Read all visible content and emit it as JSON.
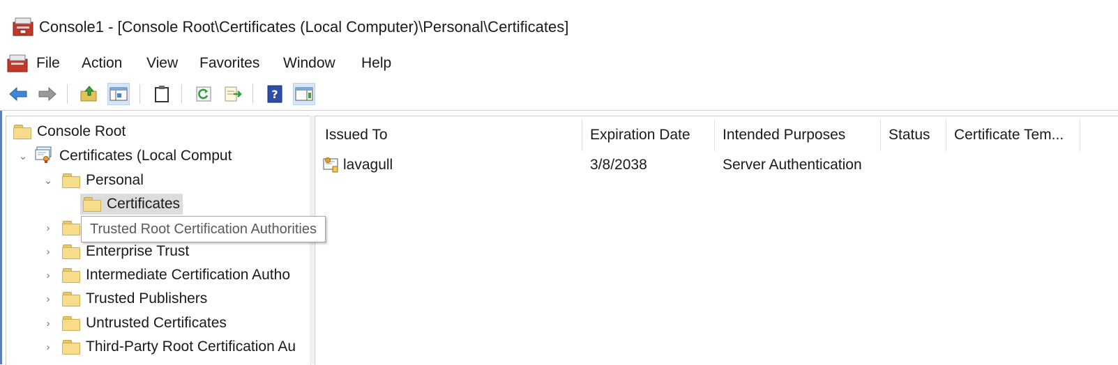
{
  "window": {
    "title": "Console1 - [Console Root\\Certificates (Local Computer)\\Personal\\Certificates]"
  },
  "menu": {
    "items": [
      "File",
      "Action",
      "View",
      "Favorites",
      "Window",
      "Help"
    ]
  },
  "toolbar": {
    "buttons": [
      "back-arrow-icon",
      "forward-arrow-icon",
      "up-folder-icon",
      "show-hide-tree-icon",
      "clipboard-icon",
      "refresh-icon",
      "export-list-icon",
      "help-icon",
      "action-pane-icon"
    ],
    "active_buttons": [
      "show-hide-tree-icon",
      "action-pane-icon"
    ]
  },
  "tree": {
    "root": "Console Root",
    "snapin": "Certificates (Local Comput",
    "personal": "Personal",
    "certificates": "Certificates",
    "trusted_root": "",
    "enterprise_trust": "Enterprise Trust",
    "intermediate": "Intermediate Certification Autho",
    "trusted_publishers": "Trusted Publishers",
    "untrusted": "Untrusted Certificates",
    "third_party": "Third-Party Root Certification Au",
    "selected": "Certificates"
  },
  "tooltip": {
    "text": "Trusted Root Certification Authorities"
  },
  "list": {
    "columns": [
      "Issued To",
      "Expiration Date",
      "Intended Purposes",
      "Status",
      "Certificate Tem..."
    ],
    "rows": [
      {
        "issued_to": "lavagull",
        "expiration_date": "3/8/2038",
        "intended_purposes": "Server Authentication",
        "status": "",
        "certificate_template": ""
      }
    ]
  },
  "colors": {
    "selection": "#dcdcdc",
    "toolbar_active": "#d6e6f8",
    "folder": "#f6dc8b",
    "window_edge": "#5b7fb7"
  }
}
